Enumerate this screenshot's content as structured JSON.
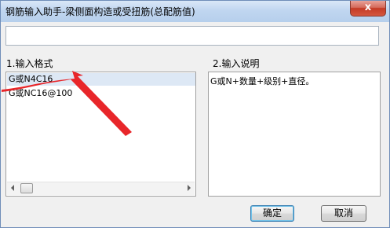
{
  "window": {
    "title": "钢筋输入助手-梁侧面构造或受扭筋(总配筋值)",
    "close_symbol": "x"
  },
  "format_section": {
    "label": "1.输入格式",
    "items": [
      "G或N4C16",
      "G或NC16@100"
    ]
  },
  "description_section": {
    "label": "2.输入说明",
    "text": "G或N+数量+级别+直径。"
  },
  "buttons": {
    "ok_label": "确定",
    "cancel_label": "取消"
  },
  "annotation": {
    "color": "#e8262a"
  }
}
